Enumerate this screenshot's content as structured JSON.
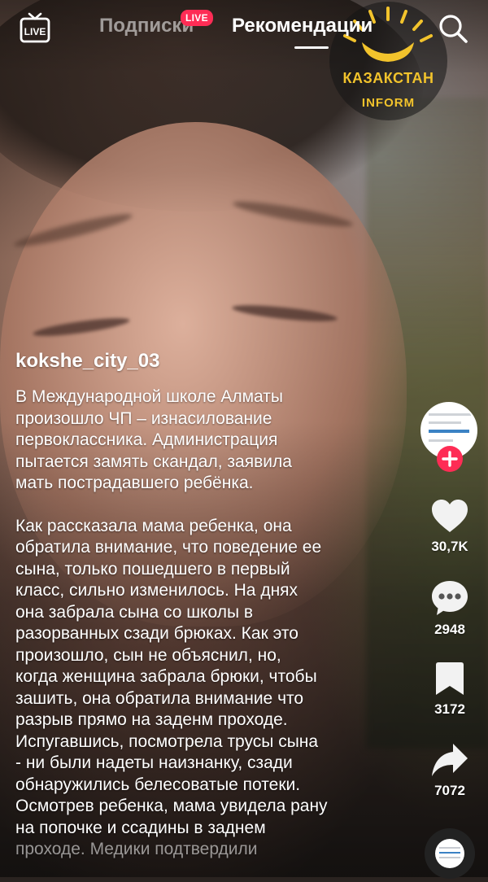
{
  "top_bar": {
    "live_label": "LIVE",
    "tab_subscriptions": "Подписки",
    "live_badge": "LIVE",
    "tab_recommendations": "Рекомендации"
  },
  "watermark": {
    "line1": "КАЗАКСТАН",
    "line2": "INFORM"
  },
  "post": {
    "author": "kokshe_city_03",
    "paragraph1": "В Международной школе Алматы\nпроизошло ЧП – изнасилование\nпервоклассника. Администрация\nпытается замять скандал, заявила\nмать пострадавшего ребёнка.",
    "paragraph2": "Как рассказала мама ребенка, она\nобратила внимание, что поведение ее\nсына, только пошедшего в первый\nкласс, сильно изменилось. На днях\nона забрала сына со школы в\nразорванных сзади брюках. Как это\nпроизошло, сын не объяснил, но,\nкогда женщина забрала брюки, чтобы\nзашить, она обратила внимание что\nразрыв прямо на заденм проходе.\nИспугавшись, посмотрела трусы сына\n- ни были надеты наизнанку, сзади\nобнаружились белесоватые потеки.\nОсмотрев ребенка, мама увидела рану\nна попочке и ссадины в заднем",
    "paragraph2_fade": "проходе. Медики подтвердили"
  },
  "actions": {
    "likes": "30,7K",
    "comments": "2948",
    "saves": "3172",
    "shares": "7072"
  },
  "icons": {
    "live": "live-tv-icon",
    "search": "search-icon",
    "follow": "plus-icon",
    "like": "heart-icon",
    "comment": "comment-bubble-icon",
    "save": "bookmark-icon",
    "share": "share-arrow-icon",
    "sound": "music-disc-icon"
  },
  "colors": {
    "accent": "#fe2c55",
    "watermark": "#f2c32c",
    "inactive_tab": "rgba(255,255,255,0.55)"
  }
}
